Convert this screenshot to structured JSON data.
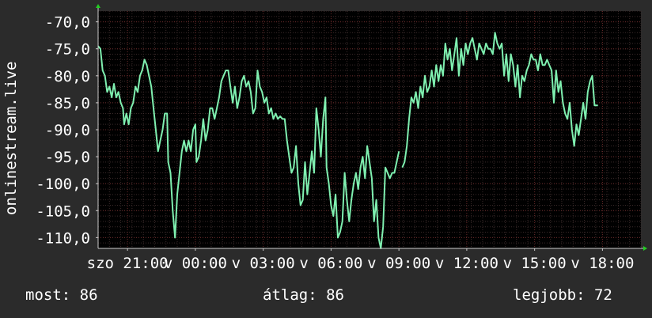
{
  "chart_data": {
    "type": "line",
    "ylabel": "onlinestream.live",
    "ylim": [
      -112,
      -68
    ],
    "yticks": [
      -70,
      -75,
      -80,
      -85,
      -90,
      -95,
      -100,
      -105,
      -110
    ],
    "ytick_labels": [
      "-70,0",
      "-75,0",
      "-80,0",
      "-85,0",
      "-90,0",
      "-95,0",
      "-100,0",
      "-105,0",
      "-110,0"
    ],
    "xlim": [
      0,
      24
    ],
    "xticks": [
      {
        "x": 1.3,
        "label": "szo 21:00"
      },
      {
        "x": 4.3,
        "label": "v 00:00"
      },
      {
        "x": 7.3,
        "label": "v 03:00"
      },
      {
        "x": 10.3,
        "label": "v 06:00"
      },
      {
        "x": 13.3,
        "label": "v 09:00"
      },
      {
        "x": 16.3,
        "label": "v 12:00"
      },
      {
        "x": 19.3,
        "label": "v 15:00"
      },
      {
        "x": 22.3,
        "label": "v 18:00"
      }
    ],
    "grid": true,
    "line_color": "#7ff0b0",
    "series": [
      {
        "segments": [
          [
            [
              0.0,
              -74.5
            ],
            [
              0.1,
              -75
            ],
            [
              0.2,
              -79
            ],
            [
              0.3,
              -80
            ],
            [
              0.4,
              -83
            ],
            [
              0.5,
              -82
            ],
            [
              0.6,
              -84
            ],
            [
              0.7,
              -81.5
            ],
            [
              0.8,
              -84
            ],
            [
              0.9,
              -83
            ],
            [
              1.0,
              -85
            ],
            [
              1.1,
              -86
            ],
            [
              1.15,
              -89
            ],
            [
              1.25,
              -87
            ],
            [
              1.35,
              -89
            ],
            [
              1.45,
              -86
            ],
            [
              1.55,
              -85
            ],
            [
              1.65,
              -82
            ],
            [
              1.75,
              -83
            ],
            [
              1.85,
              -80
            ],
            [
              1.95,
              -79
            ],
            [
              2.05,
              -77
            ],
            [
              2.15,
              -78
            ],
            [
              2.25,
              -80
            ],
            [
              2.35,
              -82
            ],
            [
              2.45,
              -86
            ],
            [
              2.55,
              -90
            ],
            [
              2.65,
              -94
            ],
            [
              2.75,
              -92
            ],
            [
              2.85,
              -90
            ],
            [
              2.95,
              -87
            ],
            [
              3.05,
              -87
            ],
            [
              3.1,
              -96
            ],
            [
              3.2,
              -98
            ],
            [
              3.3,
              -105
            ],
            [
              3.4,
              -110
            ],
            [
              3.5,
              -102
            ],
            [
              3.6,
              -98
            ],
            [
              3.7,
              -94
            ],
            [
              3.8,
              -92
            ],
            [
              3.9,
              -94
            ],
            [
              4.0,
              -92
            ],
            [
              4.1,
              -94
            ],
            [
              4.2,
              -90
            ],
            [
              4.3,
              -89
            ],
            [
              4.35,
              -96
            ],
            [
              4.45,
              -95
            ],
            [
              4.55,
              -92
            ],
            [
              4.65,
              -88
            ],
            [
              4.75,
              -92
            ],
            [
              4.85,
              -90
            ],
            [
              4.95,
              -86
            ],
            [
              5.05,
              -86
            ],
            [
              5.15,
              -88
            ],
            [
              5.25,
              -86
            ],
            [
              5.35,
              -84
            ],
            [
              5.45,
              -81
            ],
            [
              5.55,
              -80
            ],
            [
              5.65,
              -79
            ],
            [
              5.75,
              -79
            ],
            [
              5.85,
              -82
            ],
            [
              5.95,
              -85
            ],
            [
              6.05,
              -82
            ],
            [
              6.15,
              -86
            ],
            [
              6.25,
              -84
            ],
            [
              6.35,
              -81
            ],
            [
              6.45,
              -80
            ],
            [
              6.55,
              -82
            ],
            [
              6.65,
              -81
            ],
            [
              6.75,
              -83
            ],
            [
              6.85,
              -87
            ],
            [
              6.95,
              -86
            ],
            [
              7.05,
              -79
            ],
            [
              7.15,
              -82
            ],
            [
              7.25,
              -83
            ],
            [
              7.35,
              -85
            ],
            [
              7.45,
              -84
            ],
            [
              7.55,
              -87
            ],
            [
              7.65,
              -86
            ],
            [
              7.75,
              -88
            ],
            [
              7.85,
              -87
            ],
            [
              7.95,
              -88
            ],
            [
              8.05,
              -87.5
            ],
            [
              8.15,
              -88
            ],
            [
              8.25,
              -88
            ],
            [
              8.35,
              -92
            ],
            [
              8.45,
              -95
            ],
            [
              8.55,
              -98
            ],
            [
              8.65,
              -97
            ],
            [
              8.75,
              -93
            ],
            [
              8.85,
              -100
            ],
            [
              8.95,
              -104
            ],
            [
              9.05,
              -103
            ],
            [
              9.15,
              -96
            ],
            [
              9.25,
              -102
            ],
            [
              9.35,
              -98
            ],
            [
              9.45,
              -94
            ],
            [
              9.55,
              -98
            ],
            [
              9.65,
              -86
            ],
            [
              9.75,
              -90
            ],
            [
              9.85,
              -95
            ],
            [
              9.95,
              -88
            ],
            [
              10.05,
              -84
            ],
            [
              10.1,
              -97
            ],
            [
              10.2,
              -100
            ],
            [
              10.3,
              -104
            ],
            [
              10.4,
              -106
            ],
            [
              10.5,
              -102
            ],
            [
              10.6,
              -110
            ],
            [
              10.7,
              -109
            ],
            [
              10.8,
              -107
            ],
            [
              10.9,
              -98
            ],
            [
              11.0,
              -103
            ],
            [
              11.1,
              -107
            ],
            [
              11.2,
              -103
            ],
            [
              11.3,
              -100
            ],
            [
              11.4,
              -98
            ],
            [
              11.5,
              -101
            ],
            [
              11.6,
              -97
            ],
            [
              11.7,
              -95
            ],
            [
              11.8,
              -99
            ],
            [
              11.9,
              -93
            ],
            [
              12.0,
              -96
            ],
            [
              12.1,
              -99
            ],
            [
              12.2,
              -107
            ],
            [
              12.3,
              -103
            ],
            [
              12.4,
              -110
            ],
            [
              12.5,
              -112
            ],
            [
              12.6,
              -108
            ],
            [
              12.7,
              -97
            ],
            [
              12.8,
              -98
            ],
            [
              12.9,
              -99
            ],
            [
              13.0,
              -98
            ],
            [
              13.1,
              -98
            ],
            [
              13.2,
              -96
            ],
            [
              13.3,
              -94
            ]
          ],
          [
            [
              13.45,
              -97
            ],
            [
              13.55,
              -96
            ],
            [
              13.65,
              -93
            ],
            [
              13.75,
              -88
            ],
            [
              13.85,
              -84
            ],
            [
              13.95,
              -85
            ],
            [
              14.05,
              -83
            ],
            [
              14.15,
              -86
            ],
            [
              14.25,
              -82
            ],
            [
              14.35,
              -84
            ],
            [
              14.45,
              -80
            ],
            [
              14.55,
              -83
            ],
            [
              14.65,
              -82
            ],
            [
              14.75,
              -79
            ],
            [
              14.85,
              -82
            ],
            [
              14.95,
              -78
            ],
            [
              15.05,
              -81
            ],
            [
              15.15,
              -78
            ],
            [
              15.25,
              -80
            ],
            [
              15.35,
              -74
            ],
            [
              15.45,
              -77
            ],
            [
              15.55,
              -75
            ],
            [
              15.65,
              -79
            ],
            [
              15.75,
              -76
            ],
            [
              15.85,
              -73
            ],
            [
              15.95,
              -80
            ],
            [
              16.05,
              -75
            ],
            [
              16.15,
              -78
            ],
            [
              16.25,
              -74
            ],
            [
              16.35,
              -76
            ],
            [
              16.45,
              -74
            ],
            [
              16.55,
              -73
            ],
            [
              16.65,
              -75
            ],
            [
              16.75,
              -77
            ],
            [
              16.85,
              -74
            ],
            [
              16.95,
              -75
            ],
            [
              17.05,
              -76
            ],
            [
              17.15,
              -74
            ],
            [
              17.25,
              -75
            ],
            [
              17.35,
              -75
            ],
            [
              17.45,
              -76
            ],
            [
              17.55,
              -72
            ],
            [
              17.65,
              -74
            ],
            [
              17.75,
              -75
            ],
            [
              17.85,
              -74
            ],
            [
              17.95,
              -80
            ],
            [
              18.05,
              -76
            ],
            [
              18.15,
              -81
            ],
            [
              18.25,
              -76
            ],
            [
              18.35,
              -78
            ],
            [
              18.45,
              -82
            ],
            [
              18.55,
              -78
            ],
            [
              18.65,
              -84
            ],
            [
              18.75,
              -80
            ],
            [
              18.85,
              -81
            ],
            [
              18.95,
              -79
            ],
            [
              19.05,
              -78
            ],
            [
              19.15,
              -76
            ],
            [
              19.25,
              -77
            ],
            [
              19.35,
              -77
            ],
            [
              19.45,
              -79
            ],
            [
              19.55,
              -76
            ],
            [
              19.65,
              -78
            ],
            [
              19.75,
              -78
            ],
            [
              19.85,
              -77
            ],
            [
              19.95,
              -78
            ],
            [
              20.05,
              -79
            ],
            [
              20.15,
              -85
            ],
            [
              20.25,
              -79
            ],
            [
              20.35,
              -83
            ],
            [
              20.45,
              -81
            ],
            [
              20.55,
              -85
            ],
            [
              20.65,
              -87
            ],
            [
              20.75,
              -88
            ],
            [
              20.85,
              -85
            ],
            [
              20.95,
              -90
            ],
            [
              21.05,
              -93
            ],
            [
              21.15,
              -89
            ],
            [
              21.25,
              -91
            ],
            [
              21.35,
              -88
            ],
            [
              21.45,
              -85
            ],
            [
              21.55,
              -88
            ],
            [
              21.65,
              -83
            ],
            [
              21.75,
              -81
            ],
            [
              21.85,
              -80
            ],
            [
              21.95,
              -85.5
            ],
            [
              22.1,
              -85.5
            ]
          ]
        ]
      }
    ]
  },
  "stats": {
    "now": "most: 86",
    "avg": "átlag: 86",
    "best": "legjobb: 72"
  }
}
